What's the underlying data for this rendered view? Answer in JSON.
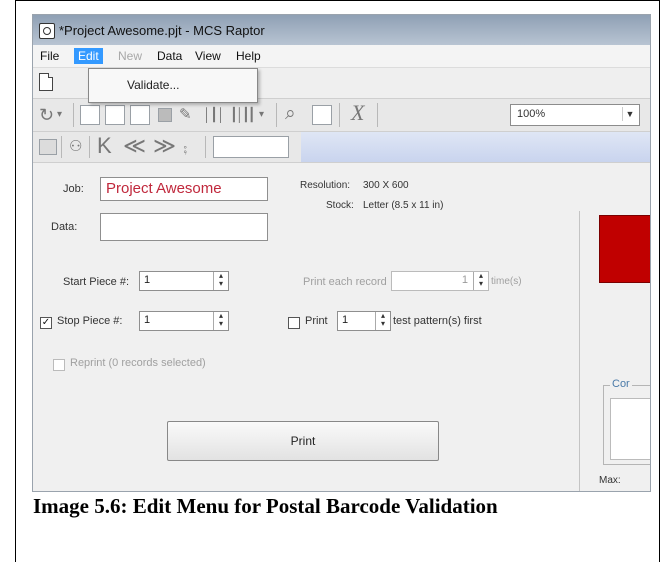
{
  "window": {
    "title": "*Project Awesome.pjt - MCS Raptor"
  },
  "menubar": {
    "items": [
      {
        "label": "File",
        "state": "normal"
      },
      {
        "label": "Edit",
        "state": "active"
      },
      {
        "label": "New",
        "state": "disabled"
      },
      {
        "label": "Data",
        "state": "normal"
      },
      {
        "label": "View",
        "state": "normal"
      },
      {
        "label": "Help",
        "state": "normal"
      }
    ]
  },
  "edit_menu": {
    "items": [
      {
        "label": "Validate..."
      }
    ]
  },
  "toolbar": {
    "zoom_value": "100%",
    "icons": [
      "new-document-icon",
      "refresh-icon",
      "form-icon",
      "layout-icon",
      "template-icon",
      "image-icon",
      "edit-icon",
      "barcode-icon",
      "barcode-dropdown-icon",
      "magnifier-icon",
      "window-icon",
      "close-x-icon",
      "binoculars-icon",
      "first-record-icon",
      "prev-page-icon",
      "next-page-icon",
      "last-record-icon"
    ]
  },
  "job": {
    "job_label": "Job:",
    "job_value": "Project Awesome",
    "data_label": "Data:",
    "data_value": ""
  },
  "settings": {
    "resolution_label": "Resolution:",
    "resolution_value": "300 X 600",
    "stock_label": "Stock:",
    "stock_value": "Letter (8.5 x 11 in)"
  },
  "pieces": {
    "start_label": "Start Piece #:",
    "start_value": "1",
    "stop_label": "Stop Piece #:",
    "stop_value": "1",
    "stop_checked": true
  },
  "print_options": {
    "each_record_label": "Print each record",
    "each_record_value": "1",
    "each_record_suffix": "time(s)",
    "print_label": "Print",
    "test_pattern_value": "1",
    "test_pattern_suffix": "test pattern(s) first",
    "reprint_label": "Reprint (0 records selected)"
  },
  "actions": {
    "print_button": "Print"
  },
  "right_panel": {
    "group_label": "Cor",
    "max_label": "Max:"
  },
  "caption": "Image 5.6: Edit Menu for Postal Barcode Validation",
  "colors": {
    "active_menu": "#3399ff",
    "job_text": "#c0283c",
    "status_block": "#c00000"
  }
}
